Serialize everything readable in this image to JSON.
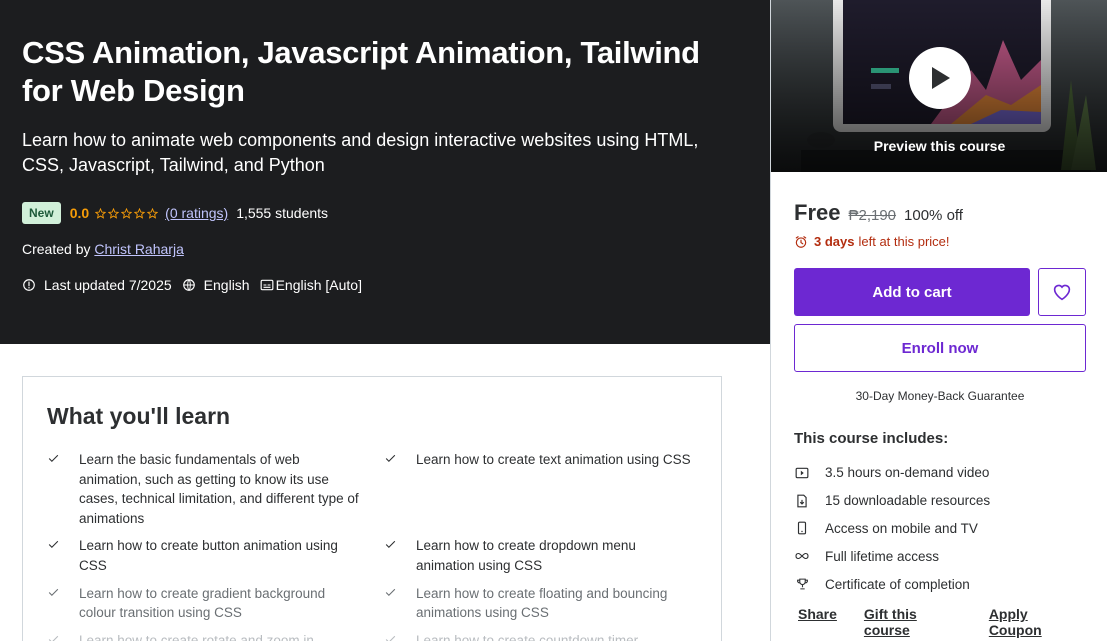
{
  "hero": {
    "title": "CSS Animation, Javascript Animation, Tailwind for Web Design",
    "subtitle": "Learn how to animate web components and design interactive websites using HTML, CSS, Javascript, Tailwind, and Python",
    "badge": "New",
    "rating": "0.0",
    "ratings_link": "(0 ratings)",
    "students": "1,555 students",
    "created_by_label": "Created by",
    "author": "Christ Raharja",
    "last_updated": "Last updated 7/2025",
    "language": "English",
    "captions": "English [Auto]"
  },
  "sidebar": {
    "preview_label": "Preview this course",
    "price": "Free",
    "original_price": "₱2,190",
    "discount": "100% off",
    "timer_days": "3 days",
    "timer_text": "left at this price!",
    "add_to_cart": "Add to cart",
    "enroll": "Enroll now",
    "guarantee": "30-Day Money-Back Guarantee",
    "includes_title": "This course includes:",
    "includes": [
      {
        "icon": "video-icon",
        "text": "3.5 hours on-demand video"
      },
      {
        "icon": "file-download-icon",
        "text": "15 downloadable resources"
      },
      {
        "icon": "mobile-icon",
        "text": "Access on mobile and TV"
      },
      {
        "icon": "infinity-icon",
        "text": "Full lifetime access"
      },
      {
        "icon": "trophy-icon",
        "text": "Certificate of completion"
      }
    ],
    "links": [
      "Share",
      "Gift this course",
      "Apply Coupon"
    ]
  },
  "learn": {
    "title": "What you'll learn",
    "items": [
      "Learn the basic fundamentals of web animation, such as getting to know its use cases, technical limitation, and different type of animations",
      "Learn how to create text animation using CSS",
      "Learn how to create button animation using CSS",
      "Learn how to create dropdown menu animation using CSS",
      "Learn how to create gradient background colour transition using CSS",
      "Learn how to create floating and bouncing animations using CSS",
      "Learn how to create rotate and zoom in",
      "Learn how to create countdown timer"
    ]
  },
  "colors": {
    "hero_bg": "#1c1d1f",
    "primary": "#6d28d2",
    "rating": "#f69c08",
    "link_on_dark": "#c0c4fc",
    "timer": "#b32d0f"
  }
}
